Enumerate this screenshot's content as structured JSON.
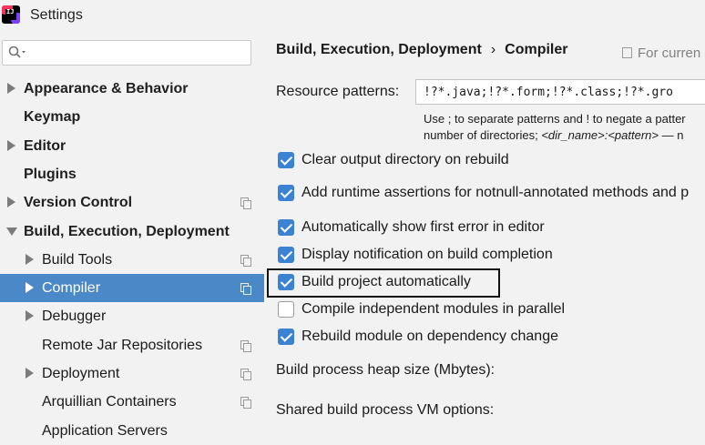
{
  "window": {
    "title": "Settings"
  },
  "sidebar": {
    "items": [
      {
        "label": "Appearance & Behavior",
        "level": 0,
        "expander": "collapsed",
        "bold": true,
        "project": false
      },
      {
        "label": "Keymap",
        "level": 0,
        "expander": "none",
        "bold": true,
        "project": false
      },
      {
        "label": "Editor",
        "level": 0,
        "expander": "collapsed",
        "bold": true,
        "project": false
      },
      {
        "label": "Plugins",
        "level": 0,
        "expander": "none",
        "bold": true,
        "project": false
      },
      {
        "label": "Version Control",
        "level": 0,
        "expander": "collapsed",
        "bold": true,
        "project": true
      },
      {
        "label": "Build, Execution, Deployment",
        "level": 0,
        "expander": "expanded",
        "bold": true,
        "project": false
      },
      {
        "label": "Build Tools",
        "level": 1,
        "expander": "collapsed",
        "bold": false,
        "project": true
      },
      {
        "label": "Compiler",
        "level": 1,
        "expander": "collapsed",
        "bold": false,
        "project": true,
        "selected": true
      },
      {
        "label": "Debugger",
        "level": 1,
        "expander": "collapsed",
        "bold": false,
        "project": false
      },
      {
        "label": "Remote Jar Repositories",
        "level": 1,
        "expander": "none",
        "bold": false,
        "project": true
      },
      {
        "label": "Deployment",
        "level": 1,
        "expander": "collapsed",
        "bold": false,
        "project": true
      },
      {
        "label": "Arquillian Containers",
        "level": 1,
        "expander": "none",
        "bold": false,
        "project": true
      },
      {
        "label": "Application Servers",
        "level": 1,
        "expander": "none",
        "bold": false,
        "project": false
      }
    ]
  },
  "header": {
    "crumb_parent": "Build, Execution, Deployment",
    "crumb_sep": "›",
    "crumb_current": "Compiler",
    "scope_text": "For curren"
  },
  "resource": {
    "label": "Resource patterns:",
    "value": "!?*.java;!?*.form;!?*.class;!?*.gro",
    "hint_line1": "Use ; to separate patterns and ! to negate a patter",
    "hint_line2_pre": "number of directories; ",
    "hint_line2_italic": "<dir_name>:<pattern>",
    "hint_line2_post": " — n"
  },
  "options": [
    {
      "label": "Clear output directory on rebuild",
      "checked": true
    },
    {
      "label": "Add runtime assertions for notnull-annotated methods and p",
      "checked": true
    },
    {
      "label": "Automatically show first error in editor",
      "checked": true
    },
    {
      "label": "Display notification on build completion",
      "checked": true
    },
    {
      "label": "Build project automatically",
      "checked": true
    },
    {
      "label": "Compile independent modules in parallel",
      "checked": false
    },
    {
      "label": "Rebuild module on dependency change",
      "checked": true
    }
  ],
  "heap_label": "Build process heap size (Mbytes):",
  "vm_label": "Shared build process VM options:",
  "colors": {
    "selection": "#4a88c7",
    "checkbox": "#3c82d2"
  }
}
